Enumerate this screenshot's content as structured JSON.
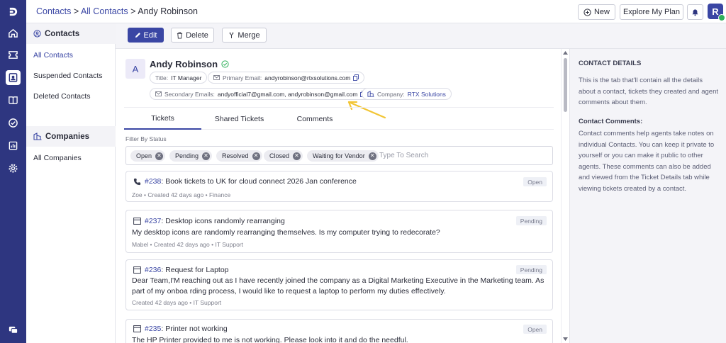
{
  "breadcrumb": {
    "contacts": "Contacts",
    "sep1": ">",
    "all_contacts": "All Contacts",
    "sep2": ">",
    "current": "Andy Robinson"
  },
  "header": {
    "new_label": "New",
    "explore_label": "Explore My Plan",
    "avatar_initial": "R"
  },
  "rail": {
    "icons": [
      "logo-icon",
      "home-icon",
      "ticket-icon",
      "contacts-icon",
      "knowledge-base-icon",
      "tasks-icon",
      "reports-icon",
      "settings-icon",
      "chat-icon"
    ]
  },
  "sidebar": {
    "contacts_title": "Contacts",
    "contacts_items": [
      "All Contacts",
      "Suspended Contacts",
      "Deleted Contacts"
    ],
    "companies_title": "Companies",
    "companies_items": [
      "All Companies"
    ]
  },
  "toolbar": {
    "edit_label": "Edit",
    "delete_label": "Delete",
    "merge_label": "Merge"
  },
  "contact": {
    "initial": "A",
    "name": "Andy Robinson",
    "title_label": "Title:",
    "title_value": "IT Manager",
    "primary_label": "Primary Email:",
    "primary_value": "andyrobinson@rtxsolutions.com",
    "secondary_label": "Secondary Emails:",
    "secondary_value": "andyofficial7@gmail.com, andyrobinson@gmail.com",
    "company_label": "Company:",
    "company_value": "RTX Solutions"
  },
  "tabs": [
    "Tickets",
    "Shared Tickets",
    "Comments"
  ],
  "filter": {
    "label": "Filter By Status",
    "chips": [
      "Open",
      "Pending",
      "Resolved",
      "Closed",
      "Waiting for Vendor"
    ],
    "placeholder": "Type To Search"
  },
  "tickets": [
    {
      "number": "#238",
      "title": ": Book tickets to UK for cloud connect 2026 Jan conference",
      "description": "",
      "meta": "Zoe  • Created 42 days ago •  Finance",
      "status": "Open"
    },
    {
      "number": "#237",
      "title": ": Desktop icons randomly rearranging",
      "description": "My desktop icons are randomly rearranging themselves. Is my computer trying to redecorate?",
      "meta": "Mabel  • Created 42 days ago •  IT Support",
      "status": "Pending"
    },
    {
      "number": "#236",
      "title": ": Request for Laptop",
      "description": "Dear Team,I'M reaching out as I have recently joined the company as a Digital Marketing Executive in the Marketing team. As part of my onboa rding process, I would like to request a laptop to perform my duties effectively.",
      "meta": "Created 42 days ago •  IT Support",
      "status": "Pending"
    },
    {
      "number": "#235",
      "title": ": Printer not working",
      "description": "The HP Printer provided to me is not working. Please look into it and do the needful.",
      "meta": "",
      "status": "Open"
    }
  ],
  "right_panel": {
    "details_title": "CONTACT DETAILS",
    "details_text": "This is the tab that'll contain all the details about a contact, tickets they created and agent comments about them.",
    "comments_title": "Contact Comments:",
    "comments_text": "Contact comments help agents take notes on individual Contacts. You can keep it private to yourself or you can make it public to other agents. These comments can also be added and viewed from the Ticket Details tab while viewing tickets created by a contact."
  },
  "colors": {
    "rail": "#2e3680",
    "accent": "#3a46a4",
    "annotation_arrow": "#f2c534"
  }
}
